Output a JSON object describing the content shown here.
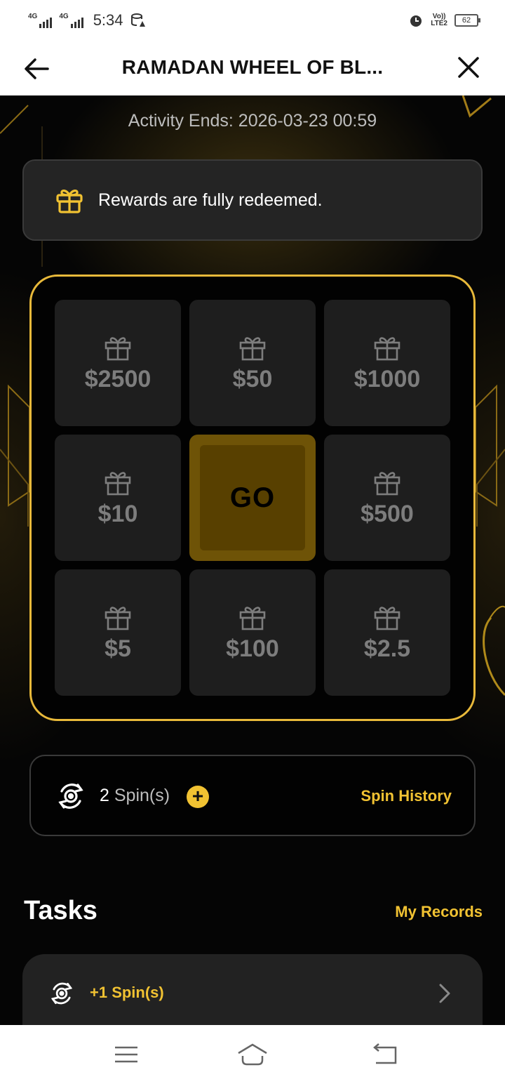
{
  "status_bar": {
    "net1": "4G",
    "net2": "4G",
    "time": "5:34",
    "volte_top": "Vo))",
    "volte_bottom": "LTE2",
    "battery": "62"
  },
  "header": {
    "title": "RAMADAN WHEEL OF BL..."
  },
  "activity": {
    "ends_text": "Activity Ends: 2026-03-23 00:59"
  },
  "notice": {
    "text": "Rewards are fully redeemed."
  },
  "wheel": {
    "prizes": [
      "$2500",
      "$50",
      "$1000",
      "$10",
      "$500",
      "$5",
      "$100",
      "$2.5"
    ],
    "go_label": "GO"
  },
  "spins": {
    "count": "2",
    "label": "Spin(s)",
    "plus": "+",
    "history_label": "Spin History"
  },
  "tasks": {
    "title": "Tasks",
    "records_label": "My Records",
    "items": [
      {
        "label": "+1 Spin(s)"
      }
    ]
  },
  "colors": {
    "accent": "#f1c232",
    "background": "#000000",
    "card": "#1e1e1e"
  }
}
